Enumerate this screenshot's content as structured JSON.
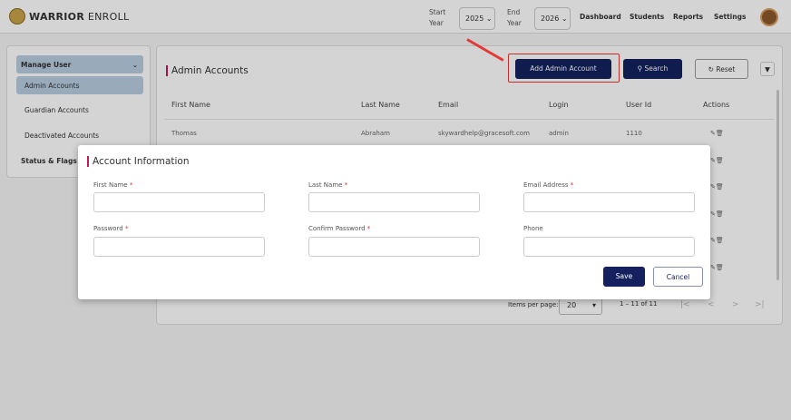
{
  "header": {
    "brand_bold": "WARRIOR",
    "brand_light": "ENROLL",
    "start_year_label": "Start Year",
    "start_year": "2025",
    "end_year_label": "End Year",
    "end_year": "2026",
    "nav": [
      "Dashboard",
      "Students",
      "Reports",
      "Settings"
    ]
  },
  "sidebar": {
    "group": "Manage User",
    "items": [
      "Admin Accounts",
      "Guardian Accounts",
      "Deactivated Accounts"
    ],
    "section2": "Status & Flags"
  },
  "main": {
    "title": "Admin Accounts",
    "add_button": "Add Admin Account",
    "search_button": "Search",
    "reset_button": "Reset",
    "columns": [
      "First Name",
      "Last Name",
      "Email",
      "Login",
      "User Id",
      "Actions"
    ],
    "rows": [
      {
        "first": "Thomas",
        "last": "Abraham",
        "email": "skywardhelp@gracesoft.com",
        "login": "admin",
        "id": "1110"
      }
    ],
    "pagination": {
      "label": "Items per page:",
      "per_page": "20",
      "range": "1 – 11 of 11"
    }
  },
  "modal": {
    "title": "Account Information",
    "fields": [
      {
        "label": "First Name",
        "required": "*"
      },
      {
        "label": "Last Name",
        "required": "*"
      },
      {
        "label": "Email Address",
        "required": "*"
      },
      {
        "label": "Password",
        "required": "*"
      },
      {
        "label": "Confirm Password",
        "required": "*"
      },
      {
        "label": "Phone"
      }
    ],
    "save": "Save",
    "cancel": "Cancel"
  },
  "colors": {
    "primary": "#14215e",
    "accent": "#c2185b",
    "highlight": "#e53935"
  }
}
